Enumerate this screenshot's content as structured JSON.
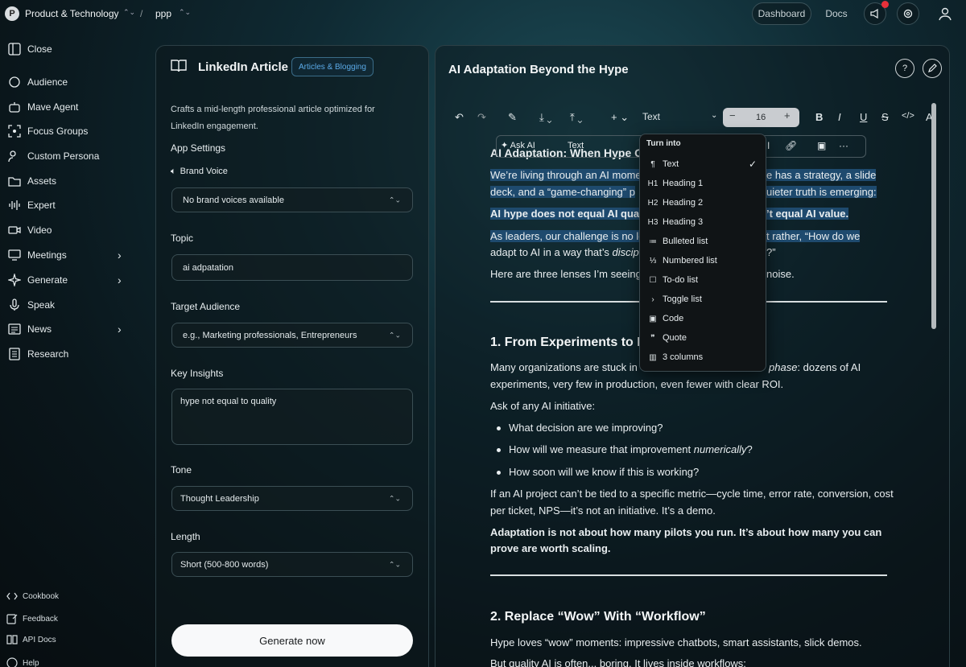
{
  "topbar": {
    "workspace_initial": "P",
    "workspace_name": "Product & Technology",
    "separator": "/",
    "project_name": "ppp",
    "dashboard_label": "Dashboard",
    "docs_label": "Docs"
  },
  "sidebar": {
    "close_label": "Close",
    "items": [
      {
        "label": "Audience"
      },
      {
        "label": "Mave Agent"
      },
      {
        "label": "Focus Groups"
      },
      {
        "label": "Custom Persona"
      },
      {
        "label": "Assets"
      },
      {
        "label": "Expert"
      },
      {
        "label": "Video"
      },
      {
        "label": "Meetings"
      },
      {
        "label": "Generate"
      },
      {
        "label": "Speak"
      },
      {
        "label": "News"
      },
      {
        "label": "Research"
      }
    ],
    "footer": [
      {
        "label": "Cookbook"
      },
      {
        "label": "Feedback"
      },
      {
        "label": "API Docs"
      },
      {
        "label": "Help"
      }
    ]
  },
  "app_panel": {
    "title": "LinkedIn Article",
    "category_tag": "Articles & Blogging",
    "description": "Crafts a mid-length professional article optimized for LinkedIn engagement.",
    "settings_heading": "App Settings",
    "brand_voice_label": "Brand Voice",
    "brand_voice_value": "No brand voices available",
    "topic_label": "Topic",
    "topic_value": "ai adpatation",
    "audience_label": "Target Audience",
    "audience_placeholder": "e.g., Marketing professionals, Entrepreneurs",
    "insights_label": "Key Insights",
    "insights_value": "hype not equal to quality",
    "tone_label": "Tone",
    "tone_value": "Thought Leadership",
    "length_label": "Length",
    "length_value": "Short (500-800 words)",
    "generate_label": "Generate now"
  },
  "editor": {
    "doc_title": "AI Adaptation Beyond the Hype",
    "toolbar": {
      "block_type": "Text",
      "font_size": "16",
      "bold": "B",
      "italic": "I",
      "underline": "U",
      "strike": "S",
      "code": "</>"
    },
    "inline_bar": {
      "ask_ai": "Ask AI",
      "text": "Text"
    },
    "content": {
      "h1": "AI Adaptation: When Hype Ou",
      "p1_left_1": "We’re living through an AI mome",
      "p1_right_1": "e has a strategy, a slide",
      "p1_left_2": "deck, and a “game-changing” p",
      "p1_right_2": "uieter truth is emerging:",
      "bold1_left": "AI hype does not equal AI qua",
      "bold1_right": "’t equal AI value.",
      "p2_left_1": "As leaders, our challenge is no lo",
      "p2_right_1": "t rather, “How do we",
      "p2_left_2_a": "adapt to AI in a way that’s ",
      "p2_left_2_b": "discip",
      "p2_right_2": "?”",
      "p3_left": "Here are three lenses I’m seeing",
      "p3_right": "noise.",
      "section1": "1. From Experiments to Ev",
      "s1_line1_left": "Many organizations are stuck in",
      "s1_line1_right_a": "phase",
      "s1_line1_right_b": ": dozens of AI",
      "s1_line2": "experiments, very few in production, even fewer with clear ROI.",
      "s1_ask": "Ask of any AI initiative:",
      "bullets": [
        "What decision are we improving?",
        "How will we measure that improvement ",
        "How soon will we know if this is working?"
      ],
      "bullet2_em": "numerically",
      "bullet2_end": "?",
      "s1_p1": "If an AI project can’t be tied to a specific metric—cycle time, error rate, conversion, cost",
      "s1_p2": "per ticket, NPS—it’s not an initiative. It’s a demo.",
      "s1_bold1": "Adaptation is not about how many pilots you run. It’s about how many you can",
      "s1_bold2": "prove are worth scaling.",
      "section2": "2. Replace “Wow” With “Workflow”",
      "s2_p1": "Hype loves “wow” moments: impressive chatbots, smart assistants, slick demos.",
      "s2_p2": "But quality AI is often... boring. It lives inside workflows:"
    },
    "turn_into": {
      "heading": "Turn into",
      "items": [
        {
          "icon": "¶",
          "label": "Text"
        },
        {
          "icon": "H1",
          "label": "Heading 1"
        },
        {
          "icon": "H2",
          "label": "Heading 2"
        },
        {
          "icon": "H3",
          "label": "Heading 3"
        },
        {
          "icon": "≔",
          "label": "Bulleted list"
        },
        {
          "icon": "⅓",
          "label": "Numbered list"
        },
        {
          "icon": "☐",
          "label": "To-do list"
        },
        {
          "icon": "›",
          "label": "Toggle list"
        },
        {
          "icon": "▣",
          "label": "Code"
        },
        {
          "icon": "❞",
          "label": "Quote"
        },
        {
          "icon": "▥",
          "label": "3 columns"
        }
      ],
      "selected": "Text"
    }
  }
}
